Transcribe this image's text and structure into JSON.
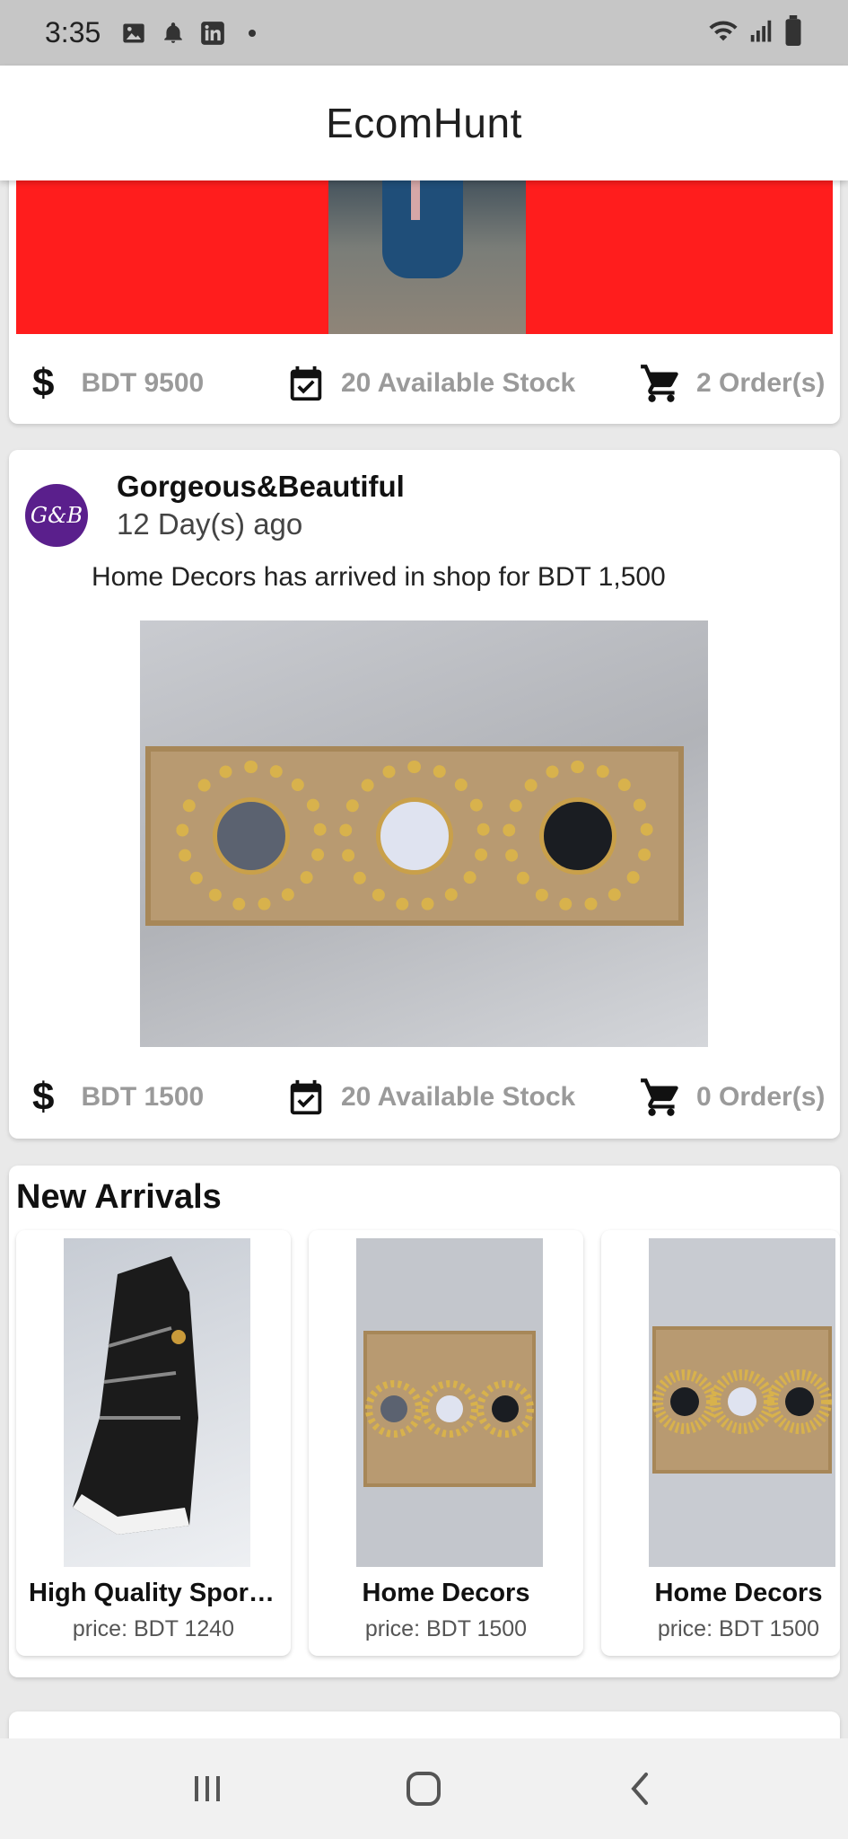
{
  "status_bar": {
    "time": "3:35"
  },
  "app": {
    "title": "EcomHunt"
  },
  "colors": {
    "banner_red": "#ff1d1d",
    "avatar_purple": "#5a1f8c",
    "meta_gray": "#9a9a9a"
  },
  "post1": {
    "price": "BDT 9500",
    "stock": "20 Available Stock",
    "orders": "2 Order(s)"
  },
  "post2": {
    "avatar_initials": "G&B",
    "shop_name": "Gorgeous&Beautiful",
    "time_ago": "12 Day(s) ago",
    "description": "Home Decors has arrived in shop for BDT 1,500",
    "price": "BDT 1500",
    "stock": "20 Available Stock",
    "orders": "0 Order(s)"
  },
  "new_arrivals": {
    "title": "New Arrivals",
    "items": [
      {
        "name": "High Quality Sport...",
        "price": "price: BDT 1240"
      },
      {
        "name": "Home Decors",
        "price": "price: BDT 1500"
      },
      {
        "name": "Home Decors",
        "price": "price: BDT 1500"
      }
    ]
  },
  "icons": [
    "image-icon",
    "bell-icon",
    "linkedin-icon",
    "wifi-icon",
    "signal-icon",
    "battery-icon",
    "dollar-icon",
    "calendar-check-icon",
    "cart-icon",
    "recents-icon",
    "home-icon",
    "back-icon"
  ]
}
